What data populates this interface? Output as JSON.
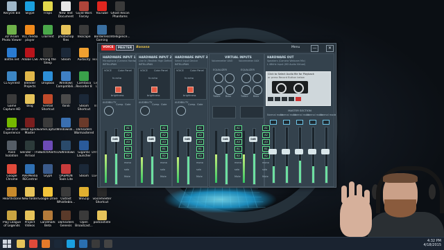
{
  "desktop_icons": [
    {
      "label": "Recycle Bin",
      "color": "#9fb7c9"
    },
    {
      "label": "3D Vision Photo Viewer",
      "color": "#6fb24a"
    },
    {
      "label": "Battle.net",
      "color": "#2a7bd1"
    },
    {
      "label": "CL-EyeTest",
      "color": "#3c86c4"
    },
    {
      "label": "Game Capture HD",
      "color": "#3a3a3a"
    },
    {
      "label": "GeForce Experience",
      "color": "#76b900"
    },
    {
      "label": "Alien Isolation",
      "color": "#555d66"
    },
    {
      "label": "Google Chrome",
      "color": "#e04a3a"
    },
    {
      "label": "Hearthstone",
      "color": "#c98b2c"
    },
    {
      "label": "Play League of Legends",
      "color": "#c9a441"
    },
    {
      "label": "Skype",
      "color": "#1aa0e0"
    },
    {
      "label": "VLC media player",
      "color": "#f08a1c"
    },
    {
      "label": "Adobe CS6",
      "color": "#b8141b"
    },
    {
      "label": "Blender Projects",
      "color": "#e0b74a"
    },
    {
      "label": "blog",
      "color": "#e6c35a"
    },
    {
      "label": "Dead Space Master",
      "color": "#7a1e1e"
    },
    {
      "label": "Slender - The Arrival",
      "color": "#2c3a3a"
    },
    {
      "label": "AVerMedia RECentral",
      "color": "#2f6fb2"
    },
    {
      "label": "New folder",
      "color": "#e6c35a"
    },
    {
      "label": "Project Videos",
      "color": "#e6c35a"
    },
    {
      "label": "Frapx",
      "color": "#e3d94c"
    },
    {
      "label": "uTorrent",
      "color": "#4aa84a"
    },
    {
      "label": "Among the Sleep",
      "color": "#2e2e2e"
    },
    {
      "label": "Dropbox",
      "color": "#2d8fd8"
    },
    {
      "label": "Firefall Shortcut",
      "color": "#c04a2a"
    },
    {
      "label": "GameCaptur...",
      "color": "#3a3a3a"
    },
    {
      "label": "TwitchAlerts",
      "color": "#6c4bb6"
    },
    {
      "label": "Glyph",
      "color": "#3a5a8a"
    },
    {
      "label": "Google Drive",
      "color": "#f2c43a"
    },
    {
      "label": "Landmark Beta",
      "color": "#b37a3a"
    },
    {
      "label": "New Text Document",
      "color": "#e6e6e6"
    },
    {
      "label": "photoshop files",
      "color": "#e6c35a"
    },
    {
      "label": "Steam",
      "color": "#1b2838"
    },
    {
      "label": "Windows Compatibili...",
      "color": "#3f7fc4"
    },
    {
      "label": "Yandi",
      "color": "#4a4a4a"
    },
    {
      "label": "Windowsdi...",
      "color": "#3a6fb0"
    },
    {
      "label": "DSWindows",
      "color": "#2a4a6a"
    },
    {
      "label": "DAEMON Tools Lite",
      "color": "#c83b3b"
    },
    {
      "label": "Outlast Whistleblo...",
      "color": "#3a3a3a"
    },
    {
      "label": "Darksiders Genesis",
      "color": "#5a3a2a"
    },
    {
      "label": "Guild Wars Farcey",
      "color": "#b0453a"
    },
    {
      "label": "Inkscape",
      "color": "#3a3a3a"
    },
    {
      "label": "Audacity",
      "color": "#f0a030"
    },
    {
      "label": "Camtasia Recorder 8",
      "color": "#3aa04a"
    },
    {
      "label": "Steam Shortcut",
      "color": "#1b2838"
    },
    {
      "label": "Darksiders Warmastered",
      "color": "#6a3a2a"
    },
    {
      "label": "Gigantic Launcher",
      "color": "#2a5a9a"
    },
    {
      "label": "Steam",
      "color": "#1b2838"
    },
    {
      "label": "WinZip",
      "color": "#e0b030"
    },
    {
      "label": "Open Broadcast...",
      "color": "#3a3a3a"
    },
    {
      "label": "YouTube",
      "color": "#e0261f"
    },
    {
      "label": "Borderless Gaming",
      "color": "#3a6fa0"
    },
    {
      "label": "TeamSpeak 3 Client",
      "color": "#2a4f80"
    },
    {
      "label": "Leagues of Legends",
      "color": "#c9a441"
    },
    {
      "label": "Intellidrive",
      "color": "#3a6fa0"
    },
    {
      "label": "Wow",
      "color": "#3a3a3a"
    },
    {
      "label": "DVSM_3.0_-...",
      "color": "#2a2a2a"
    },
    {
      "label": "LGHD Stream Engine",
      "color": "#2a2a2a"
    },
    {
      "label": "voicemeeter Shortcut",
      "color": "#2a2a2a"
    },
    {
      "label": "podcastiste",
      "color": "#e6c35a"
    },
    {
      "label": "Ghost Recon Phantoms",
      "color": "#3a3a3a"
    },
    {
      "label": "Intelligence...",
      "color": "#3a3a3a"
    },
    {
      "label": "rect085",
      "color": "#e6e6e6"
    },
    {
      "label": "Logitech Webca...",
      "color": "#2a2a2a"
    },
    {
      "label": "Canbo",
      "color": "#e6c35a"
    }
  ],
  "voicemeeter": {
    "logo": {
      "part1": "VOICE",
      "part2": "MEETER",
      "part3": "Banana"
    },
    "menu_label": "Menu",
    "minimize_label": "—",
    "close_label": "✕",
    "hardware_inputs": [
      {
        "title": "HARDWARE INPUT 1",
        "device": "Microphone (Camera Hardware)"
      },
      {
        "title": "HARDWARE INPUT 2",
        "device": "Line In (Realtek High Definitio"
      },
      {
        "title": "HARDWARE INPUT 3",
        "device": "Select Input Device"
      }
    ],
    "virtual_inputs": {
      "title": "VIRTUAL INPUTS",
      "device1": "Voicemeeter VAIO",
      "device2": "Voicemeeter AUX"
    },
    "hardware_out": {
      "title": "HARDWARE OUT",
      "device": "Speakers (Camera Webcam Mic)",
      "device2": "L 48kHz Input (HD Audio Virtual)"
    },
    "intellipan_label": "INTELLIPAN",
    "voice_label": "VOICE",
    "color_panel_label": "Color Panel",
    "fx_echo_label": "fx echo",
    "brightness_label": "brightness",
    "audibility_label": "AUDIBILITY",
    "comp_label": "Comp.",
    "gate_label": "Gate",
    "equalizer_label": "EQUALIZER",
    "treble_label": "Treble",
    "bass_label": "Bass",
    "bus_labels": [
      "A1",
      "A2",
      "A3",
      "B1",
      "B2"
    ],
    "mono_label": "mono",
    "solo_label": "solo",
    "mute_label": "Mute",
    "fader_caps": [
      "0dB",
      "0dB",
      "0dB",
      "0dB",
      "0dB"
    ],
    "input_levels": [
      0.55,
      0.5,
      0.5,
      0.55,
      0.55
    ],
    "tape": {
      "header": "Click to Select Audio file for Playback",
      "subheader": "or press Record Button below"
    },
    "master_title": "MASTER SECTION",
    "master_channels": [
      "Normal mode",
      "Normal mode",
      "Normal mode",
      "Normal mode",
      "Normal mode"
    ],
    "master_levels": [
      0.3,
      0.3,
      0.4,
      0.3,
      0.3
    ]
  },
  "taskbar": {
    "time": "4:32 PM",
    "date": "4/18/2015",
    "pinned": [
      {
        "name": "file-explorer",
        "color": "#e6c35a"
      },
      {
        "name": "chrome",
        "color": "#e04a3a"
      },
      {
        "name": "firefox",
        "color": "#e57a2a"
      },
      {
        "name": "steam",
        "color": "#1b2838"
      },
      {
        "name": "skype",
        "color": "#1aa0e0"
      },
      {
        "name": "photoshop",
        "color": "#2a6fb0"
      },
      {
        "name": "voicemeeter",
        "color": "#3a3a3a"
      },
      {
        "name": "obs",
        "color": "#444"
      }
    ]
  }
}
